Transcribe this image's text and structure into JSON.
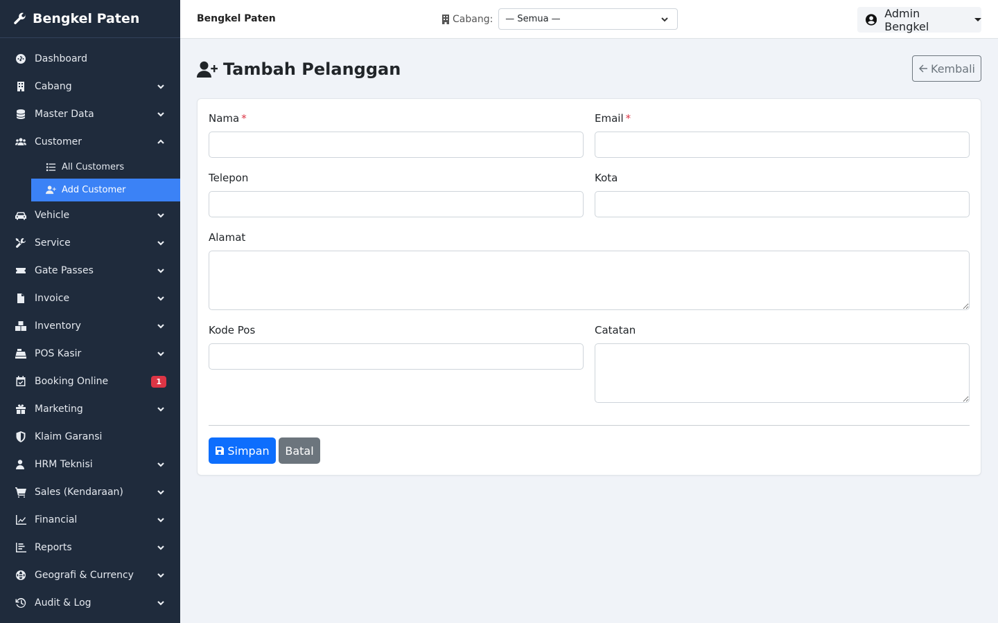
{
  "sidebar": {
    "brand": "Bengkel Paten",
    "items": [
      {
        "label": "Dashboard"
      },
      {
        "label": "Cabang"
      },
      {
        "label": "Master Data"
      },
      {
        "label": "Customer"
      },
      {
        "label": "Vehicle"
      },
      {
        "label": "Service"
      },
      {
        "label": "Gate Passes"
      },
      {
        "label": "Invoice"
      },
      {
        "label": "Inventory"
      },
      {
        "label": "POS Kasir"
      },
      {
        "label": "Booking Online",
        "badge": "1"
      },
      {
        "label": "Marketing"
      },
      {
        "label": "Klaim Garansi"
      },
      {
        "label": "HRM Teknisi"
      },
      {
        "label": "Sales (Kendaraan)"
      },
      {
        "label": "Financial"
      },
      {
        "label": "Reports"
      },
      {
        "label": "Geografi & Currency"
      },
      {
        "label": "Audit & Log"
      }
    ],
    "customer_sub": [
      {
        "label": "All Customers"
      },
      {
        "label": "Add Customer",
        "active": true
      }
    ]
  },
  "topbar": {
    "brand": "Bengkel Paten",
    "branch_label": "Cabang:",
    "branch_value": "— Semua —",
    "user": "Admin Bengkel"
  },
  "page": {
    "title": "Tambah Pelanggan",
    "back_label": "Kembali"
  },
  "form": {
    "nama": {
      "label": "Nama",
      "required": "*",
      "value": ""
    },
    "email": {
      "label": "Email",
      "required": "*",
      "value": ""
    },
    "telepon": {
      "label": "Telepon",
      "value": ""
    },
    "kota": {
      "label": "Kota",
      "value": ""
    },
    "alamat": {
      "label": "Alamat",
      "value": ""
    },
    "kode_pos": {
      "label": "Kode Pos",
      "value": ""
    },
    "catatan": {
      "label": "Catatan",
      "value": ""
    },
    "save_label": "Simpan",
    "cancel_label": "Batal"
  },
  "colors": {
    "sidebar_bg": "#1f2b3c",
    "active_bg": "#3b82f6",
    "primary": "#0d6efd",
    "secondary": "#6c757d",
    "danger": "#dc3545"
  }
}
